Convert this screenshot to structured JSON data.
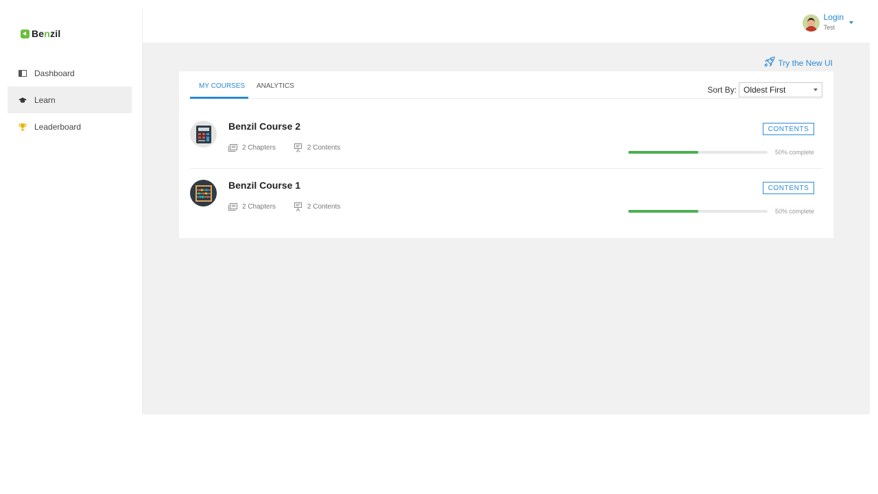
{
  "brand": {
    "logo_text_pre": "Be",
    "logo_text_hl": "n",
    "logo_text_post": "zil"
  },
  "sidebar": {
    "items": [
      {
        "label": "Dashboard",
        "icon": "dashboard-icon",
        "active": false
      },
      {
        "label": "Learn",
        "icon": "graduation-cap-icon",
        "active": true
      },
      {
        "label": "Leaderboard",
        "icon": "trophy-icon",
        "active": false
      }
    ]
  },
  "header": {
    "user_name": "Login",
    "user_sub": "Test"
  },
  "main": {
    "try_new_ui": "Try the New UI",
    "tabs": [
      {
        "label": "MY COURSES",
        "active": true
      },
      {
        "label": "ANALYTICS",
        "active": false
      }
    ],
    "sort": {
      "label": "Sort By:",
      "value": "Oldest First"
    },
    "courses": [
      {
        "title": "Benzil Course 2",
        "chapters": "2 Chapters",
        "contents": "2 Contents",
        "button": "CONTENTS",
        "progress": 0.5,
        "progress_text": "50% complete",
        "thumb": "calculator-icon"
      },
      {
        "title": "Benzil Course 1",
        "chapters": "2 Chapters",
        "contents": "2 Contents",
        "button": "CONTENTS",
        "progress": 0.5,
        "progress_text": "50% complete",
        "thumb": "abacus-icon"
      }
    ]
  },
  "colors": {
    "accent": "#2a8ad6",
    "progress": "#4caf50",
    "brand_green": "#6bbf3a",
    "background": "#f1f1f1"
  }
}
